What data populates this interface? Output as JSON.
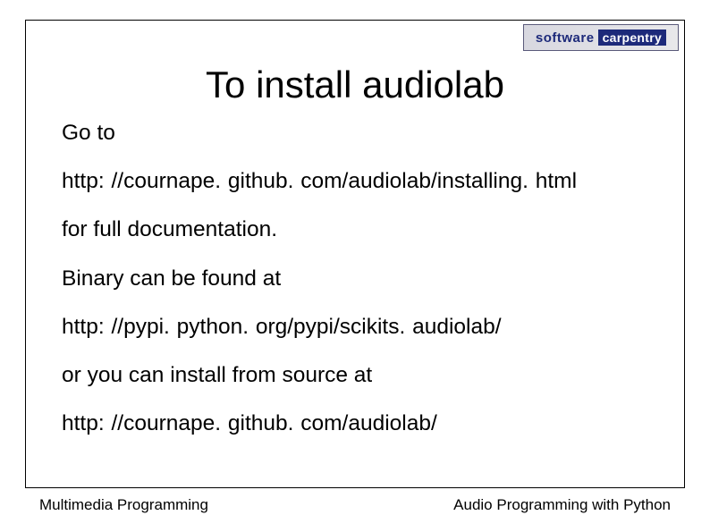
{
  "logo": {
    "software": "software",
    "carpentry": "carpentry"
  },
  "title": "To install audiolab",
  "body": {
    "line1": "Go to",
    "line2": "http: //cournape. github. com/audiolab/installing. html",
    "line3": "for full documentation.",
    "line4": "Binary can be found at",
    "line5": "http: //pypi. python. org/pypi/scikits. audiolab/",
    "line6": "or you can install from source at",
    "line7": "http: //cournape. github. com/audiolab/"
  },
  "footer": {
    "left": "Multimedia Programming",
    "right": "Audio Programming with Python"
  }
}
